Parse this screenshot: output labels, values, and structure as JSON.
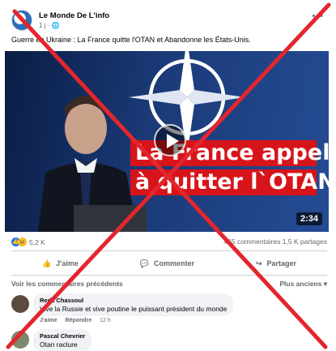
{
  "post": {
    "author": "Le Monde De L'info",
    "time": "1 j",
    "privacy_icon": "globe-icon",
    "text": "Guerre en Ukraine : La France quitte l'OTAN et Abandonne les États-Unis."
  },
  "video": {
    "title_line1": "La France appel",
    "title_line2": "à quitter l`OTAN.",
    "duration": "2:34"
  },
  "stats": {
    "reaction_count": "5,2 K",
    "comments": "465 commentaires",
    "shares": "1,5 K partages"
  },
  "actions": {
    "like": "J'aime",
    "comment": "Commenter",
    "share": "Partager"
  },
  "comments_section": {
    "previous": "Voir les commentaires précédents",
    "sort": "Plus anciens"
  },
  "comments": [
    {
      "name": "Reda Chassoul",
      "text": "Vive la Russie et vive poutine le puissant président du monde",
      "like": "J'aime",
      "reply": "Répondre",
      "time": "12 h"
    },
    {
      "name": "Pascal Chevrier",
      "text": "Otan raclure"
    }
  ],
  "colors": {
    "cross": "#e3262d",
    "accent": "#1877f2"
  }
}
